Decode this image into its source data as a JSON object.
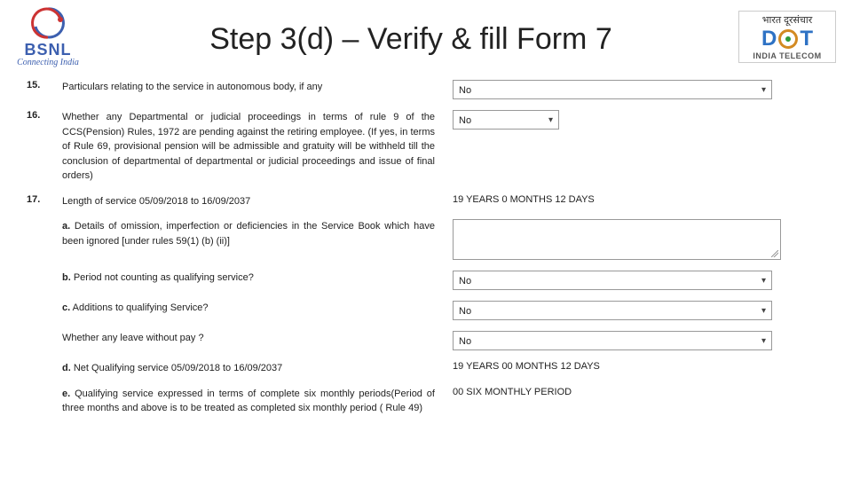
{
  "header": {
    "bsnl_name": "BSNL",
    "bsnl_tagline": "Connecting India",
    "title": "Step 3(d) – Verify & fill Form 7",
    "dot_hindi": "भारत दूरसंचार",
    "dot_bottom": "INDIA TELECOM"
  },
  "rows": {
    "r15": {
      "num": "15.",
      "label": "Particulars relating to the service in autonomous body, if any",
      "value": "No"
    },
    "r16": {
      "num": "16.",
      "label": "Whether any Departmental or judicial proceedings in terms of rule 9 of the CCS(Pension) Rules, 1972 are pending against the retiring employee. (If yes, in terms of Rule 69, provisional pension will be admissible and gratuity will be withheld till the conclusion of departmental of departmental or judicial proceedings and issue of final orders)",
      "value": "No"
    },
    "r17": {
      "num": "17.",
      "label": "Length of service 05/09/2018 to 16/09/2037",
      "value": "19 YEARS 0 MONTHS 12 DAYS"
    },
    "r17a": {
      "label_prefix": "a.",
      "label": "Details of omission, imperfection or deficiencies in the Service Book which have been ignored [under rules 59(1) (b) (ii)]",
      "value": ""
    },
    "r17b": {
      "label_prefix": "b.",
      "label": "Period not counting as qualifying service?",
      "value": "No"
    },
    "r17c": {
      "label_prefix": "c.",
      "label": "Additions to qualifying Service?",
      "value": "No"
    },
    "r17lwp": {
      "label": "Whether any leave without pay ?",
      "value": "No"
    },
    "r17d": {
      "label_prefix": "d.",
      "label": "Net Qualifying service 05/09/2018 to 16/09/2037",
      "value": "19 YEARS 00 MONTHS 12 DAYS"
    },
    "r17e": {
      "label_prefix": "e.",
      "label": "Qualifying service expressed in terms of complete six monthly periods(Period of three months and above is to be treated as completed six monthly period ( Rule 49)",
      "value": "00 SIX MONTHLY PERIOD"
    }
  }
}
